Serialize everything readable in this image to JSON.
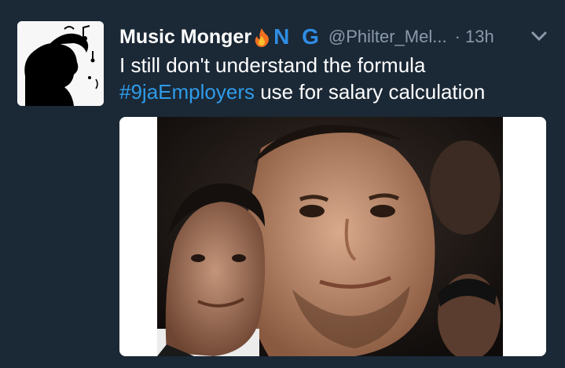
{
  "tweet": {
    "author": {
      "display_name": "Music Monger",
      "flag_text": "N G",
      "handle": "@Philter_Mel...",
      "badge_icon": "fire-icon"
    },
    "time": "· 13h",
    "text_line1": "I still don't understand the formula",
    "hashtag": "#9jaEmployers",
    "text_line2_rest": " use for salary calculation",
    "menu_icon": "chevron-down-icon"
  },
  "colors": {
    "background": "#1b2836",
    "link": "#2f9be8",
    "muted": "#8a9aab"
  }
}
